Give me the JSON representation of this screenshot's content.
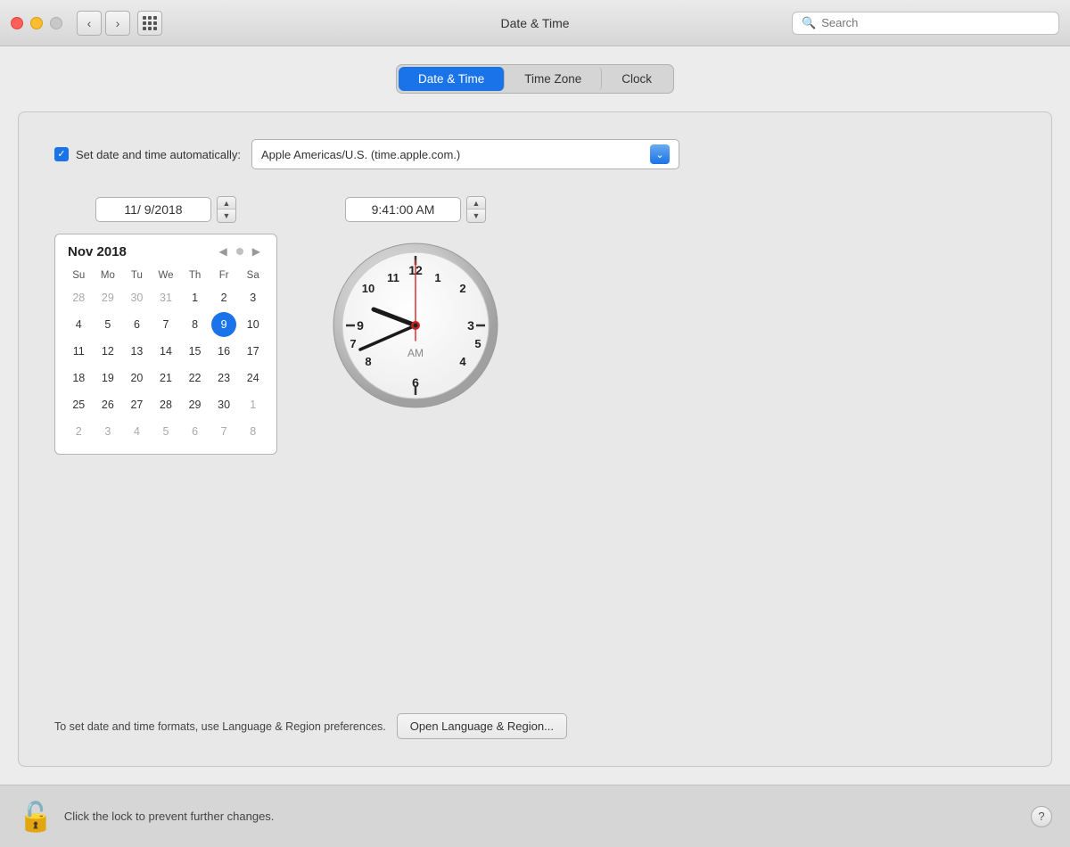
{
  "titlebar": {
    "title": "Date & Time",
    "search_placeholder": "Search"
  },
  "tabs": [
    {
      "id": "date-time",
      "label": "Date & Time",
      "active": true
    },
    {
      "id": "time-zone",
      "label": "Time Zone",
      "active": false
    },
    {
      "id": "clock",
      "label": "Clock",
      "active": false
    }
  ],
  "auto_set": {
    "label": "Set date and time automatically:",
    "checked": true,
    "server": "Apple Americas/U.S. (time.apple.com.)"
  },
  "date": {
    "value": "11/  9/2018"
  },
  "time": {
    "value": "9:41:00 AM"
  },
  "calendar": {
    "month_year": "Nov 2018",
    "day_headers": [
      "Su",
      "Mo",
      "Tu",
      "We",
      "Th",
      "Fr",
      "Sa"
    ],
    "weeks": [
      [
        "28",
        "29",
        "30",
        "31",
        "1",
        "2",
        "3"
      ],
      [
        "4",
        "5",
        "6",
        "7",
        "8",
        "9",
        "10"
      ],
      [
        "11",
        "12",
        "13",
        "14",
        "15",
        "16",
        "17"
      ],
      [
        "18",
        "19",
        "20",
        "21",
        "22",
        "23",
        "24"
      ],
      [
        "25",
        "26",
        "27",
        "28",
        "29",
        "30",
        "1"
      ],
      [
        "2",
        "3",
        "4",
        "5",
        "6",
        "7",
        "8"
      ]
    ],
    "other_month_days": [
      "28",
      "29",
      "30",
      "31",
      "1",
      "2",
      "3",
      "1",
      "2",
      "3",
      "4",
      "5",
      "6",
      "7",
      "8"
    ],
    "selected_day": "9"
  },
  "clock_am": "AM",
  "bottom": {
    "text": "To set date and time formats, use Language & Region preferences.",
    "button_label": "Open Language & Region..."
  },
  "lock": {
    "text": "Click the lock to prevent further changes.",
    "help_label": "?"
  }
}
